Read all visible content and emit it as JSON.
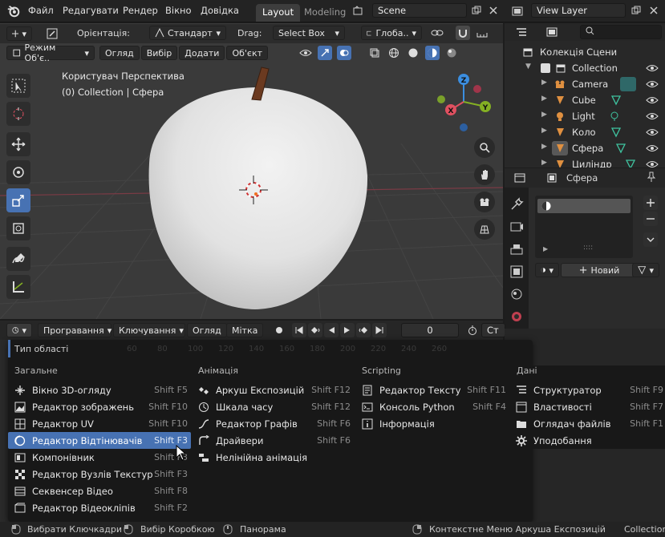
{
  "topbar": {
    "menus": [
      "Файл",
      "Редагувати",
      "Рендер",
      "Вікно",
      "Довідка"
    ],
    "workspaces": [
      "Layout",
      "Modeling"
    ],
    "scene": "Scene",
    "view_layer": "View Layer"
  },
  "viewport_header": {
    "orientation_label": "Орієнтація:",
    "orientation_value": "Стандарт",
    "drag_label": "Drag:",
    "drag_value": "Select Box",
    "pivot_value": "Глоба..",
    "mode": "Режим Об'є..",
    "menus": [
      "Огляд",
      "Вибір",
      "Додати",
      "Об'єкт"
    ]
  },
  "viewport": {
    "line1": "Користувач Перспектива",
    "line2": "(0) Collection | Сфера",
    "gizmo": {
      "x": "X",
      "y": "Y",
      "z": "Z"
    }
  },
  "outliner": {
    "root": "Колекція Сцени",
    "collection": "Collection",
    "items": [
      "Camera",
      "Cube",
      "Light",
      "Коло",
      "Сфера",
      "Циліндр"
    ]
  },
  "properties": {
    "object": "Сфера",
    "new_button": "Новий"
  },
  "timeline": {
    "menus": [
      "Програвання",
      "Ключування",
      "Огляд",
      "Мітка"
    ],
    "frame": "0",
    "start": "Ст"
  },
  "area_menu": {
    "title": "Тип області",
    "ruler": [
      "60",
      "80",
      "100",
      "120",
      "140",
      "160",
      "180",
      "200",
      "220",
      "240",
      "260"
    ],
    "columns": [
      {
        "title": "Загальне",
        "items": [
          {
            "label": "Вікно 3D-огляду",
            "shortcut": "Shift F5"
          },
          {
            "label": "Редактор зображень",
            "shortcut": "Shift F10"
          },
          {
            "label": "Редактор UV",
            "shortcut": "Shift F10"
          },
          {
            "label": "Редактор Відтінювачів",
            "shortcut": "Shift F3"
          },
          {
            "label": "Компонівник",
            "shortcut": "Shift F3"
          },
          {
            "label": "Редактор Вузлів Текстур",
            "shortcut": "Shift F3"
          },
          {
            "label": "Секвенсер Відео",
            "shortcut": "Shift F8"
          },
          {
            "label": "Редактор Відеокліпів",
            "shortcut": "Shift F2"
          }
        ]
      },
      {
        "title": "Анімація",
        "items": [
          {
            "label": "Аркуш Експозицій",
            "shortcut": "Shift F12"
          },
          {
            "label": "Шкала часу",
            "shortcut": "Shift F12"
          },
          {
            "label": "Редактор Графів",
            "shortcut": "Shift F6"
          },
          {
            "label": "Драйвери",
            "shortcut": "Shift F6"
          },
          {
            "label": "Нелінійна анімація",
            "shortcut": ""
          }
        ]
      },
      {
        "title": "Scripting",
        "items": [
          {
            "label": "Редактор Тексту",
            "shortcut": "Shift F11"
          },
          {
            "label": "Консоль Python",
            "shortcut": "Shift F4"
          },
          {
            "label": "Інформація",
            "shortcut": ""
          }
        ]
      },
      {
        "title": "Дані",
        "items": [
          {
            "label": "Структуратор",
            "shortcut": "Shift F9"
          },
          {
            "label": "Властивості",
            "shortcut": "Shift F7"
          },
          {
            "label": "Оглядач файлів",
            "shortcut": "Shift F1"
          },
          {
            "label": "Уподобання",
            "shortcut": ""
          }
        ]
      }
    ]
  },
  "statusbar": {
    "items": [
      "Вибрати Ключкадри",
      "Вибір Коробкою",
      "Панорама",
      "Контекстне Меню Аркуша Експозицій",
      "Collection"
    ]
  },
  "colors": {
    "accent": "#4772b3",
    "axis_x": "#e05060",
    "axis_y": "#84b023",
    "axis_z": "#3b8ee0"
  }
}
